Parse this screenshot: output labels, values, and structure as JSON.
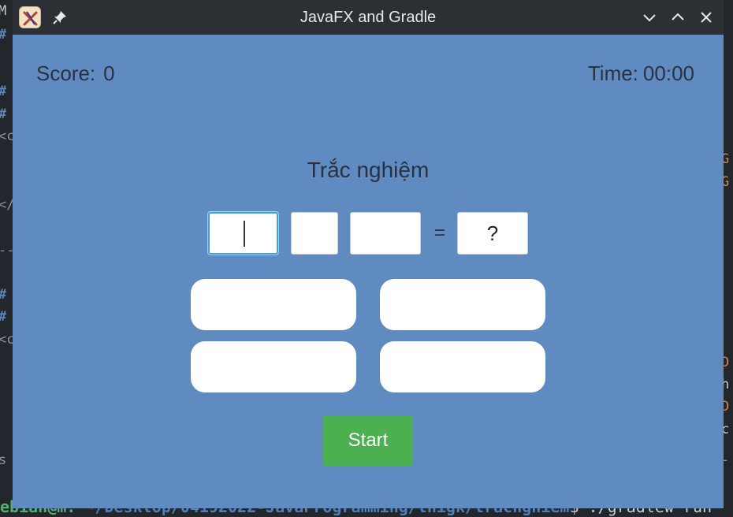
{
  "window": {
    "title": "JavaFX and Gradle"
  },
  "game": {
    "score_label": "Score:",
    "score_value": "0",
    "time_label": "Time:",
    "time_value": "00:00",
    "title": "Trắc nghiệm",
    "operand_a": "",
    "operator": "",
    "operand_b": "",
    "equals": "=",
    "answer": "?",
    "choices": [
      "",
      "",
      "",
      ""
    ],
    "start_label": "Start"
  },
  "terminal": {
    "left_lines": [
      "M",
      "#",
      "#",
      "#",
      "#",
      "<c",
      "</",
      "--",
      "#",
      "#",
      "<c",
      "s"
    ],
    "right_lines": [
      "G",
      "G",
      "D",
      "h",
      "D",
      "c",
      "-"
    ],
    "prompt_user": "ebian@m:",
    "prompt_path": "~/Desktop/04192022-JavaProgramming/thigk/tracnghiem",
    "prompt_cmd": "$ ./gradlew run"
  },
  "colors": {
    "window_bg": "#5f8bc1",
    "titlebar_bg": "#2c2f34",
    "start_button": "#4caf50",
    "focus_border": "#3aa6dd"
  },
  "icons": [
    "app-icon",
    "pin-icon",
    "minimize-icon",
    "maximize-icon",
    "close-icon"
  ]
}
